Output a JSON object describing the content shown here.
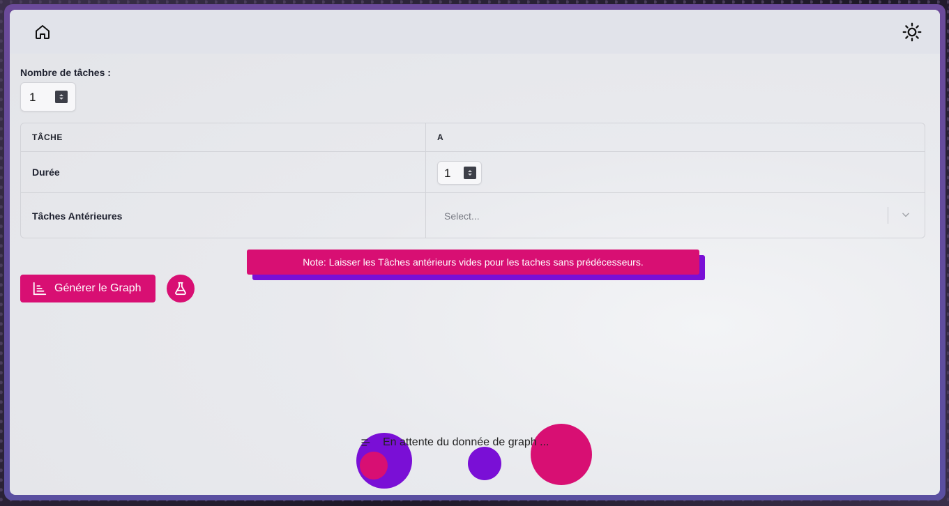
{
  "topbar": {
    "home_icon": "home-icon",
    "theme_icon": "sun-icon"
  },
  "task_count": {
    "label": "Nombre de tâches :",
    "value": "1"
  },
  "table": {
    "header": {
      "col1": "TÂCHE",
      "col2": "A"
    },
    "duration_row": {
      "label": "Durée",
      "value": "1"
    },
    "predecessors_row": {
      "label": "Tâches Antérieures",
      "placeholder": "Select..."
    }
  },
  "note": {
    "text": "Note: Laisser les Tâches antérieurs vides pour les taches sans prédécesseurs."
  },
  "actions": {
    "generate_label": "Générer le Graph",
    "generate_icon": "chart-icon",
    "flask_icon": "flask-icon"
  },
  "status": {
    "waiting_text": "En attente du donnée de graph ...",
    "waiting_icon": "list-icon"
  },
  "colors": {
    "accent": "#d80f73",
    "accent_shadow": "#7a0fd6",
    "purple_circle": "#7a0fd6"
  }
}
